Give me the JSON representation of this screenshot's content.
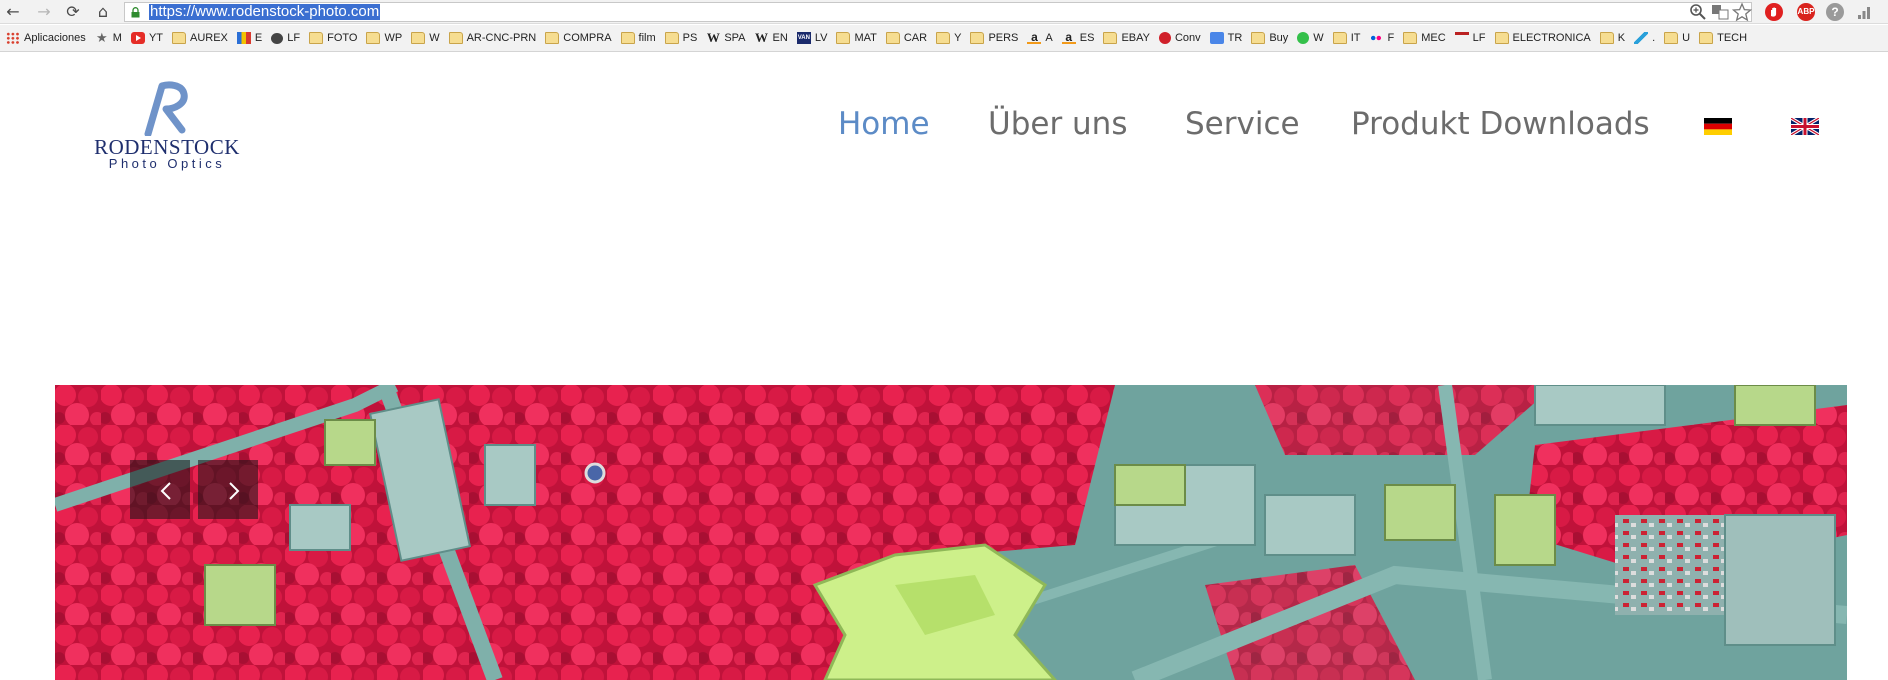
{
  "browser": {
    "url": "https://www.rodenstock-photo.com",
    "nav": {
      "back": "←",
      "forward": "→",
      "reload": "⟳",
      "home": "⌂"
    },
    "toolbar_icons": [
      "zoom-icon",
      "translate-icon",
      "star-icon"
    ],
    "extensions": [
      {
        "name": "adblock-icon",
        "color": "#e02020"
      },
      {
        "name": "abp-icon",
        "label": "ABP",
        "color": "#d9231d"
      },
      {
        "name": "help-icon",
        "label": "?",
        "color": "#9a9a9a"
      }
    ]
  },
  "bookmarks": [
    {
      "label": "Aplicaciones",
      "icon": "apps"
    },
    {
      "label": "M",
      "icon": "star"
    },
    {
      "label": "YT",
      "icon": "yt"
    },
    {
      "label": "AUREX",
      "icon": "folder"
    },
    {
      "label": "E",
      "icon": "book"
    },
    {
      "label": "LF",
      "icon": "chat"
    },
    {
      "label": "FOTO",
      "icon": "folder"
    },
    {
      "label": "WP",
      "icon": "folder"
    },
    {
      "label": "W",
      "icon": "folder"
    },
    {
      "label": "AR-CNC-PRN",
      "icon": "folder"
    },
    {
      "label": "COMPRA",
      "icon": "folder"
    },
    {
      "label": "film",
      "icon": "folder"
    },
    {
      "label": "PS",
      "icon": "folder"
    },
    {
      "label": "SPA",
      "icon": "wiki"
    },
    {
      "label": "EN",
      "icon": "wiki"
    },
    {
      "label": "LV",
      "icon": "van"
    },
    {
      "label": "MAT",
      "icon": "folder"
    },
    {
      "label": "CAR",
      "icon": "folder"
    },
    {
      "label": "Y",
      "icon": "folder"
    },
    {
      "label": "PERS",
      "icon": "folder"
    },
    {
      "label": "A",
      "icon": "amazon"
    },
    {
      "label": "ES",
      "icon": "amazon"
    },
    {
      "label": "EBAY",
      "icon": "folder"
    },
    {
      "label": "Conv",
      "icon": "conv"
    },
    {
      "label": "TR",
      "icon": "tr"
    },
    {
      "label": "Buy",
      "icon": "folder"
    },
    {
      "label": "W",
      "icon": "wa"
    },
    {
      "label": "IT",
      "icon": "folder"
    },
    {
      "label": "F",
      "icon": "flickr"
    },
    {
      "label": "MEC",
      "icon": "folder"
    },
    {
      "label": "LF",
      "icon": "lfbar"
    },
    {
      "label": "ELECTRONICA",
      "icon": "folder"
    },
    {
      "label": "K",
      "icon": "folder"
    },
    {
      "label": ".",
      "icon": "tg"
    },
    {
      "label": "U",
      "icon": "folder"
    },
    {
      "label": "TECH",
      "icon": "folder"
    }
  ],
  "site": {
    "logo": {
      "name": "RODENSTOCK",
      "tagline": "Photo Optics",
      "color": "#1f2f6e",
      "mark_color": "#6f93c9"
    },
    "nav": [
      {
        "label": "Home",
        "active": true
      },
      {
        "label": "Über uns",
        "active": false
      },
      {
        "label": "Service",
        "active": false
      },
      {
        "label": "Produkt Downloads",
        "active": false
      }
    ],
    "languages": [
      {
        "name": "flag-germany-icon",
        "lang": "de"
      },
      {
        "name": "flag-uk-icon",
        "lang": "en"
      }
    ],
    "colors": {
      "nav_active": "#5c8bc6",
      "nav_inactive": "#6c6c6c"
    },
    "slider": {
      "prev": "‹",
      "next": "›",
      "image": "false-color infrared aerial photo of a town"
    }
  }
}
